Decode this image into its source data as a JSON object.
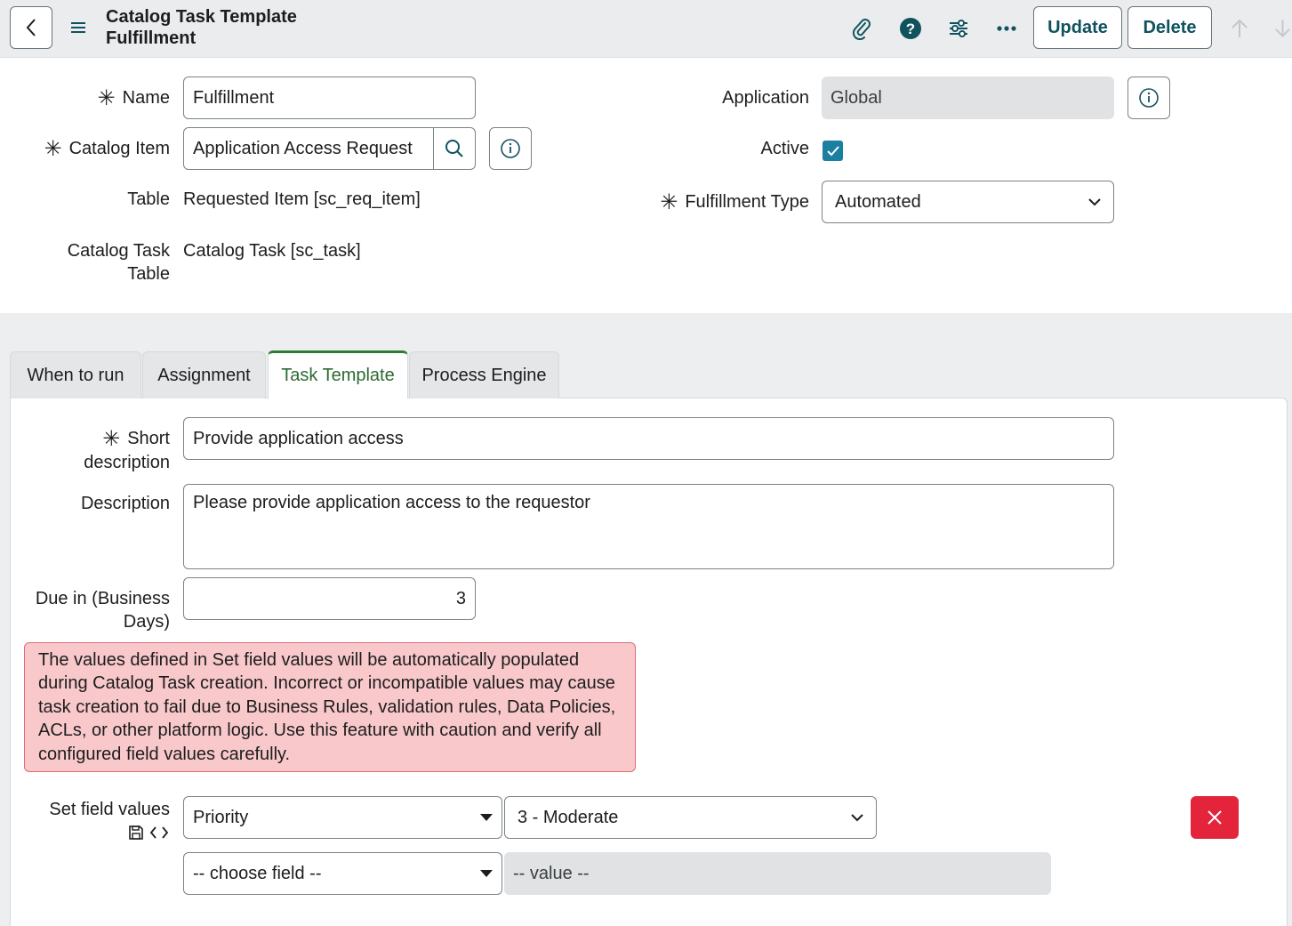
{
  "header": {
    "title": "Catalog Task Template Fulfillment",
    "update_label": "Update",
    "delete_label": "Delete"
  },
  "form": {
    "name_label": "Name",
    "name_value": "Fulfillment",
    "catalog_item_label": "Catalog Item",
    "catalog_item_value": "Application Access Request",
    "table_label": "Table",
    "table_value": "Requested Item [sc_req_item]",
    "catalog_task_table_label": "Catalog Task Table",
    "catalog_task_table_value": "Catalog Task [sc_task]",
    "application_label": "Application",
    "application_value": "Global",
    "active_label": "Active",
    "active_checked": true,
    "fulfillment_type_label": "Fulfillment Type",
    "fulfillment_type_value": "Automated"
  },
  "tabs": [
    {
      "label": "When to run",
      "active": false
    },
    {
      "label": "Assignment",
      "active": false
    },
    {
      "label": "Task Template",
      "active": true
    },
    {
      "label": "Process Engine",
      "active": false
    }
  ],
  "task_template": {
    "short_description_label": "Short description",
    "short_description_value": "Provide application access",
    "description_label": "Description",
    "description_value": "Please provide application access to the requestor",
    "due_in_label": "Due in (Business Days)",
    "due_in_value": "3",
    "alert_text": "The values defined in Set field values will be automatically populated during Catalog Task creation. Incorrect or incompatible values may cause task creation to fail due to Business Rules, validation rules, Data Policies, ACLs, or other platform logic. Use this feature with caution and verify all configured field values carefully.",
    "set_field_values_label": "Set field values",
    "field_1": "Priority",
    "value_1": "3 - Moderate",
    "field_2_placeholder": "-- choose field --",
    "value_2_placeholder": "-- value --"
  },
  "colors": {
    "accent": "#10535f",
    "active_tab": "#2e7d32",
    "alert_bg": "#f8c8cb",
    "delete": "#e3243b",
    "checkbox": "#1a7fa0"
  }
}
